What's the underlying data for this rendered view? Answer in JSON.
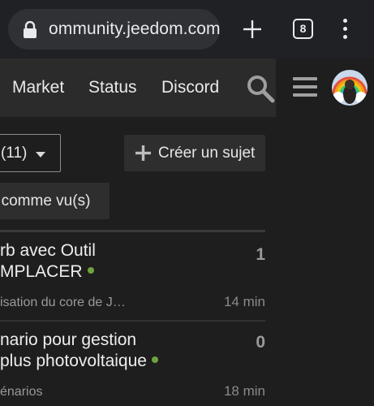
{
  "browser": {
    "url": "ommunity.jeedom.com",
    "tab_count": "8",
    "icons": {
      "lock": "lock-icon",
      "new_tab": "plus-icon",
      "menu": "more-vert-icon"
    }
  },
  "nav": {
    "links": [
      "Market",
      "Status",
      "Discord"
    ],
    "icons": {
      "search": "search-icon",
      "menu": "hamburger-icon",
      "avatar": "avatar"
    }
  },
  "controls": {
    "filter_label": "(11)",
    "create_label": "Créer un sujet",
    "mark_read_label": "r comme vu(s)"
  },
  "topics": [
    {
      "title_line1": "rb avec Outil",
      "title_line2": "MPLACER",
      "category": "isation du core de J…",
      "count": "1",
      "time": "14 min"
    },
    {
      "title_line1": "nario pour gestion",
      "title_line2": "plus photovoltaique",
      "category": "énarios",
      "count": "0",
      "time": "18 min"
    }
  ],
  "colors": {
    "page_bg": "#1e1e1e",
    "header_bg": "#2b2b2b",
    "unread_dot": "#6fa33f",
    "muted_text": "#9a9a9a"
  }
}
